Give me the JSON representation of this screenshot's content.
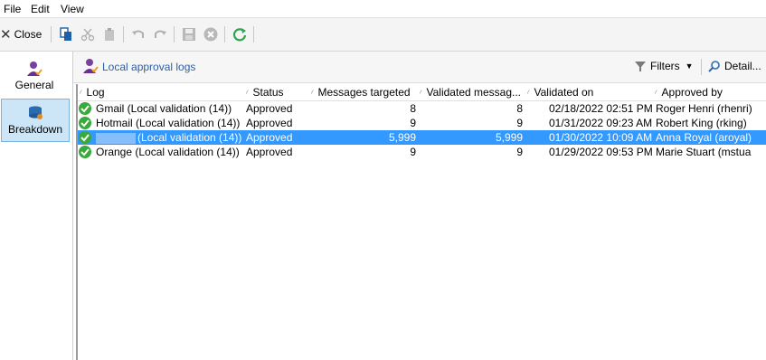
{
  "menu": {
    "file": "File",
    "edit": "Edit",
    "view": "View"
  },
  "toolbar": {
    "close_label": "Close"
  },
  "nav": [
    {
      "label": "General"
    },
    {
      "label": "Breakdown"
    }
  ],
  "content": {
    "title": "Local approval logs",
    "filters_label": "Filters",
    "detail_label": "Detail..."
  },
  "grid": {
    "columns": [
      "Log",
      "Status",
      "Messages targeted",
      "Validated messag...",
      "Validated on",
      "Approved by"
    ],
    "rows": [
      {
        "log": "Gmail (Local validation (14))",
        "status": "Approved",
        "targeted": "8",
        "validated": "8",
        "date": "02/18/2022 02:51 PM",
        "approved_by": "Roger Henri (rhenri)"
      },
      {
        "log": "Hotmail (Local validation (14))",
        "status": "Approved",
        "targeted": "9",
        "validated": "9",
        "date": "01/31/2022 09:23 AM",
        "approved_by": "Robert King (rking)"
      },
      {
        "log": "(Local validation (14))",
        "status": "Approved",
        "targeted": "5,999",
        "validated": "5,999",
        "date": "01/30/2022 10:09 AM",
        "approved_by": "Anna Royal (aroyal)"
      },
      {
        "log": "Orange (Local validation (14))",
        "status": "Approved",
        "targeted": "9",
        "validated": "9",
        "date": "01/29/2022 09:53 PM",
        "approved_by": "Marie Stuart (mstua"
      }
    ]
  },
  "colors": {
    "selection": "#3399ff",
    "link": "#2b5fa8",
    "ok": "#3aa83a",
    "refresh": "#2ea44f"
  }
}
